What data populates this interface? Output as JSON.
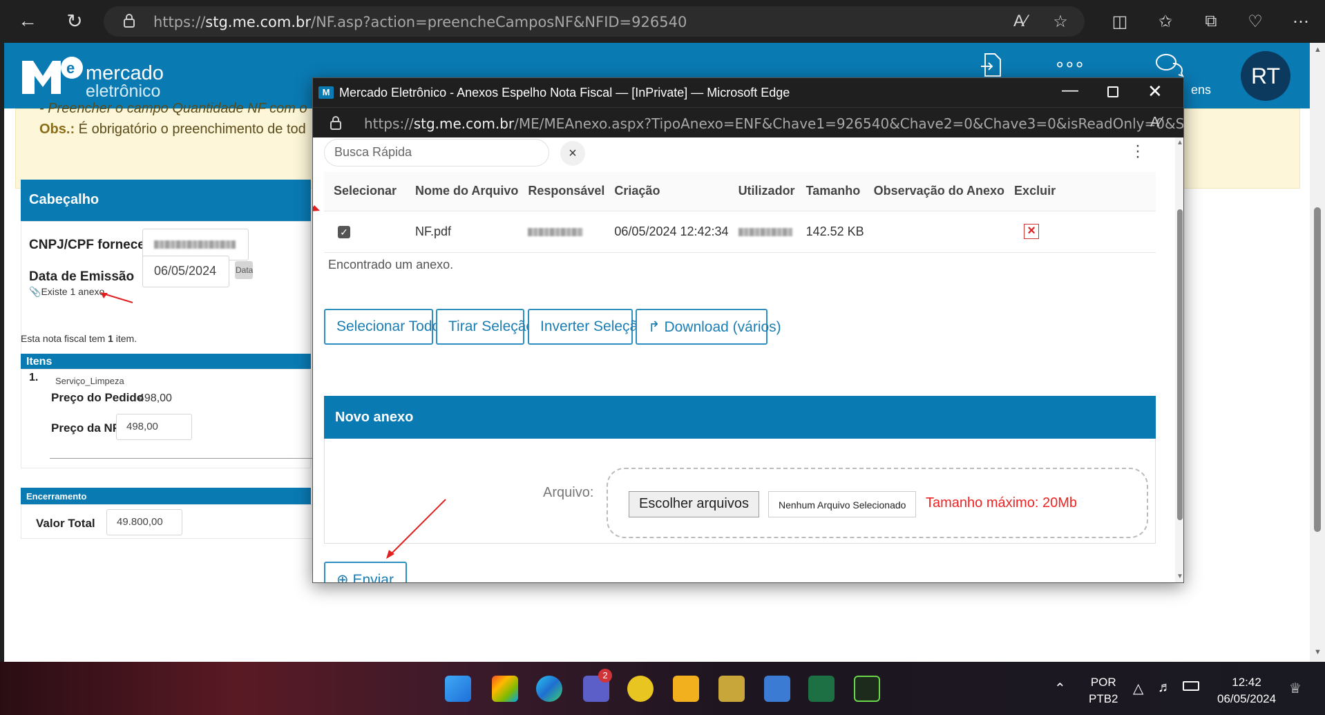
{
  "browser": {
    "url_prefix": "https://",
    "url_host": "stg.me.com.br",
    "url_path": "/NF.asp?action=preencheCamposNF&NFID=926540"
  },
  "header": {
    "brand_line1": "mercado",
    "brand_line2": "eletrônico",
    "avatar_initials": "RT",
    "messages_label_partial": "ens"
  },
  "notice": {
    "line1": "- Preencher o campo Quantidade NF com o",
    "obs_label": "Obs.:",
    "line2": " É obrigatório o preenchimento de tod"
  },
  "cabecalho": {
    "title": "Cabeçalho",
    "cnpj_label": "CNPJ/CPF fornecedor:",
    "emissao_label": "Data de Emissão",
    "emissao_value": "06/05/2024",
    "data_button": "Data",
    "anexo_link": "Existe 1 anexo"
  },
  "itens": {
    "summary_prefix": "Esta nota fiscal tem ",
    "summary_count": "1",
    "summary_suffix": " item.",
    "title": "Itens",
    "number": "1.",
    "service": "Serviço_Limpeza",
    "preco_pedido_label": "Preço do Pedido",
    "preco_pedido_value": "498,00",
    "preco_nf_label": "Preço da NF",
    "preco_nf_value": "498,00"
  },
  "encerramento": {
    "title": "Encerramento",
    "valor_total_label": "Valor Total",
    "valor_total_value": "49.800,00"
  },
  "popup": {
    "window_title": "Mercado Eletrônico - Anexos Espelho Nota Fiscal — [InPrivate] — Microsoft Edge",
    "url_prefix": "https://",
    "url_host": "stg.me.com.br",
    "url_path": "/ME/MEAnexo.aspx?TipoAnexo=ENF&Chave1=926540&Chave2=0&Chave3=0&isReadOnly=0&S...",
    "search_placeholder": "Busca Rápida",
    "columns": [
      "Selecionar",
      "Nome do Arquivo",
      "Responsável",
      "Criação",
      "Utilizador",
      "Tamanho",
      "Observação do Anexo",
      "Excluir"
    ],
    "row": {
      "file_name": "NF.pdf",
      "created": "06/05/2024 12:42:34",
      "size": "142.52 KB"
    },
    "found_text": "Encontrado um anexo.",
    "btn_select_all": "Selecionar Todos",
    "btn_clear": "Tirar Seleção",
    "btn_invert": "Inverter Seleção",
    "btn_download": "Download (vários)",
    "novo_anexo_title": "Novo anexo",
    "arquivo_label": "Arquivo:",
    "choose_files": "Escolher arquivos",
    "no_file": "Nenhum Arquivo Selecionado",
    "max_size": "Tamanho máximo: 20Mb",
    "send": "Enviar"
  },
  "taskbar": {
    "lang": "POR",
    "layout": "PTB2",
    "time": "12:42",
    "date": "06/05/2024",
    "teams_badge": "2"
  },
  "colors": {
    "brand_blue": "#0a7ab3",
    "red_text": "#e22222",
    "annotation_arrow": "#e02020"
  }
}
